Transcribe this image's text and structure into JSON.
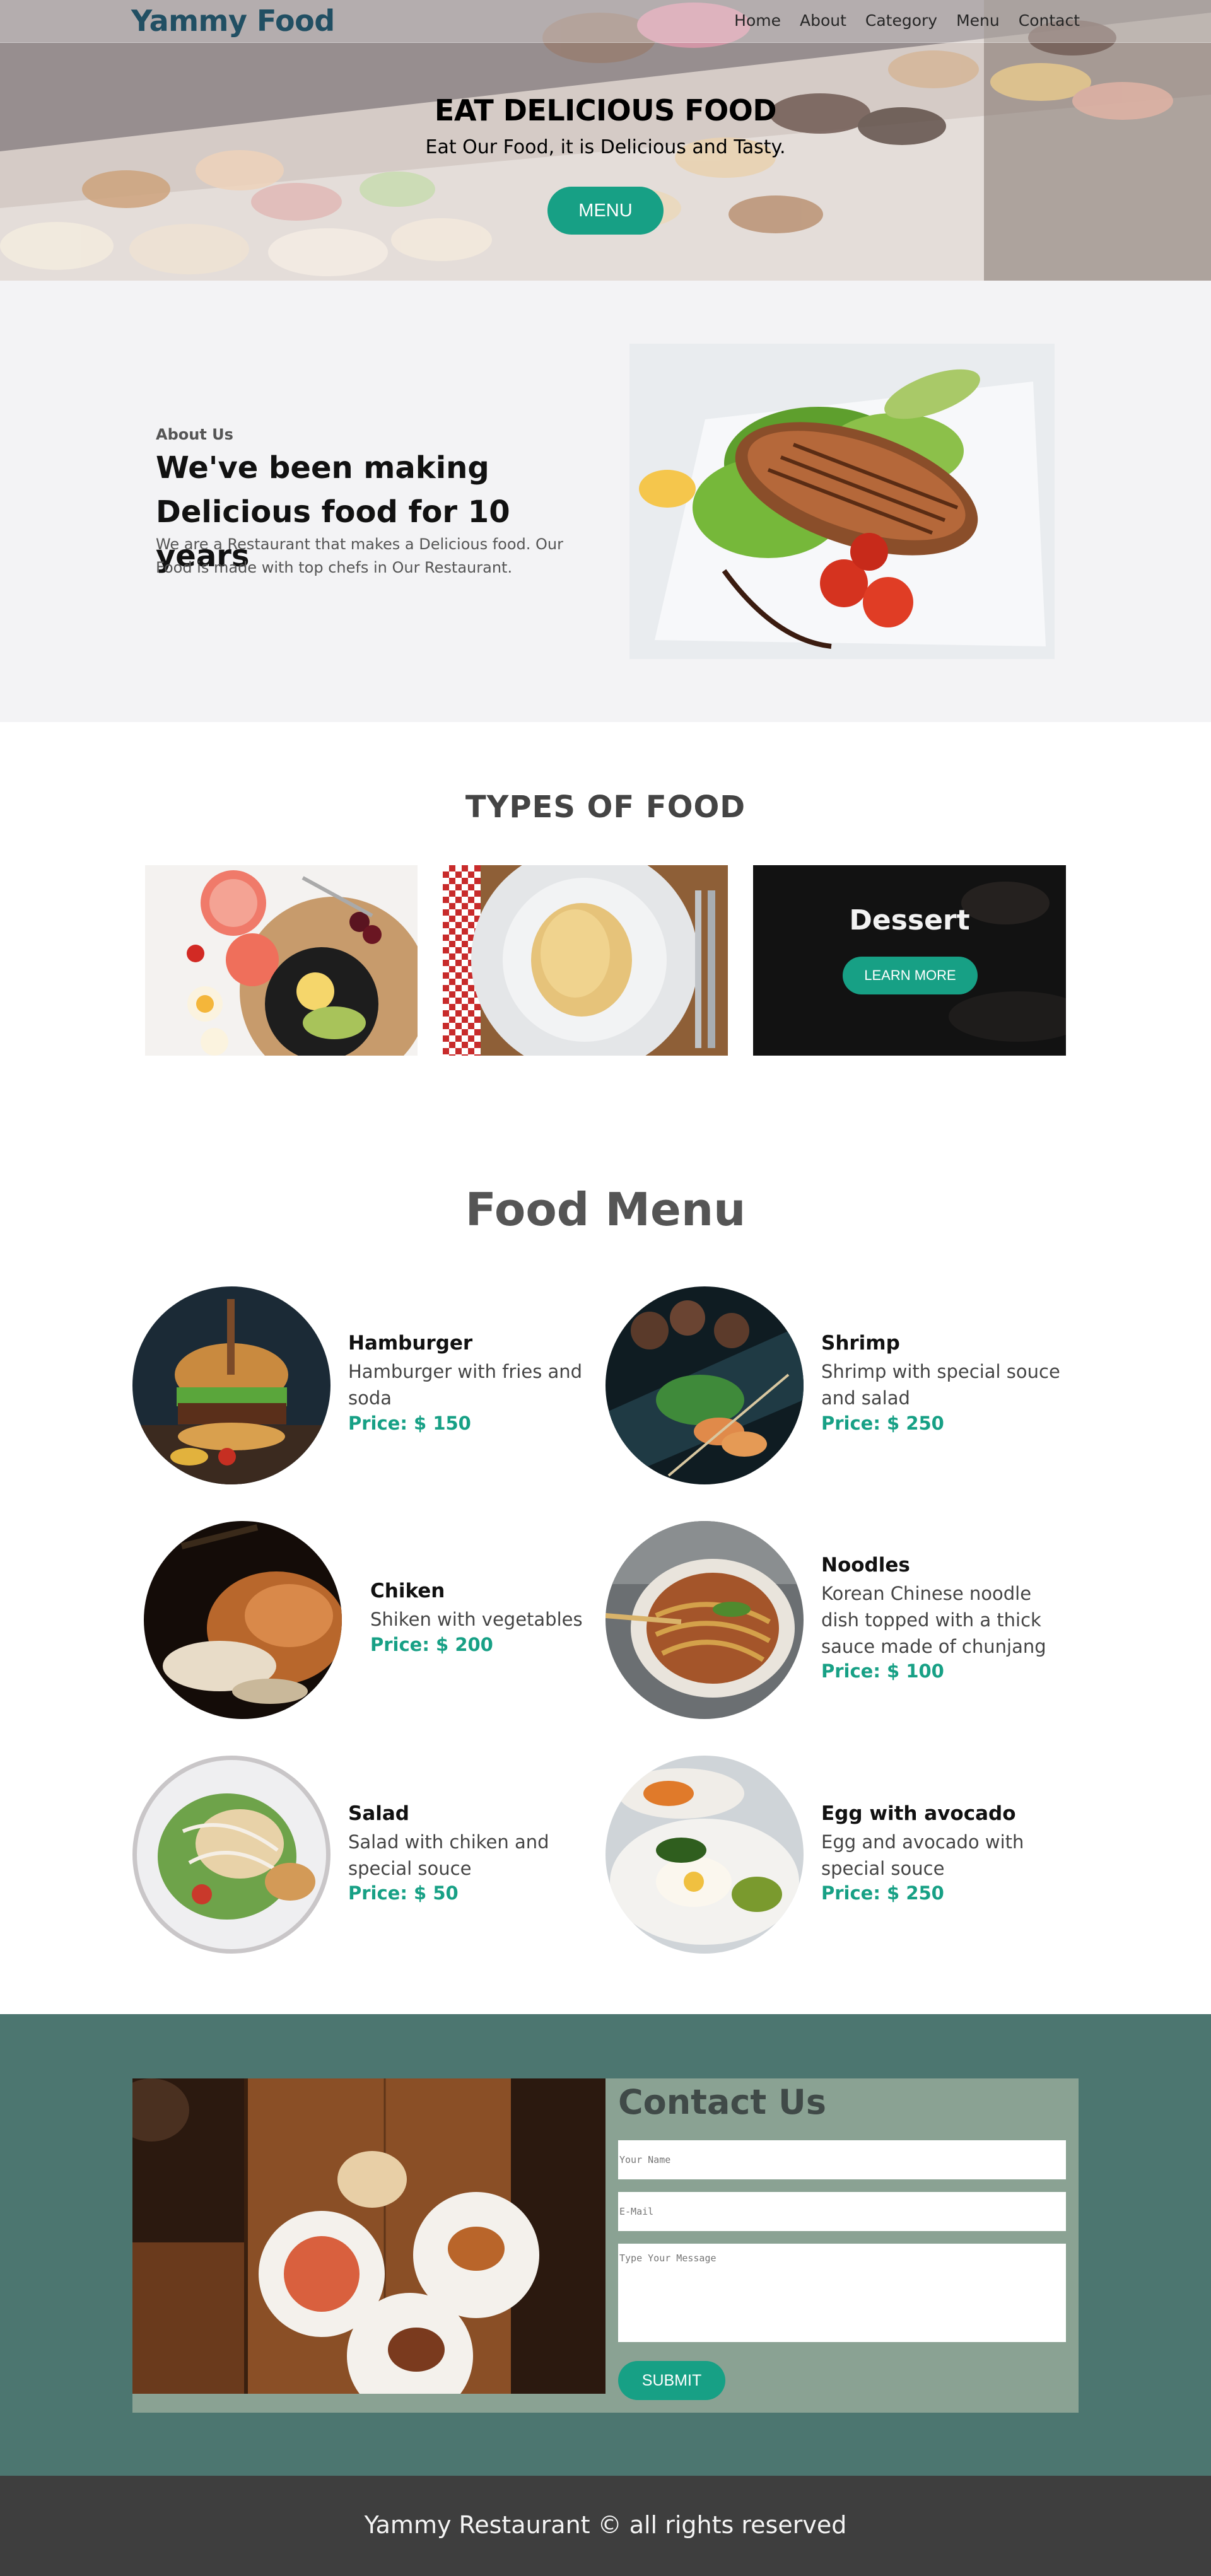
{
  "header": {
    "logo": "Yammy Food",
    "nav": [
      "Home",
      "About",
      "Category",
      "Menu",
      "Contact"
    ]
  },
  "hero": {
    "title": "EAT DELICIOUS FOOD",
    "subtitle": "Eat Our Food, it is Delicious and Tasty.",
    "button": "MENU"
  },
  "about": {
    "kicker": "About Us",
    "title": "We've been making Delicious food for 10 years",
    "text": "We are a Restaurant that makes a Delicious food. Our Food is made with top chefs in Our Restaurant."
  },
  "types": {
    "title": "TYPES OF FOOD",
    "dessert_title": "Dessert",
    "learn_more": "LEARN MORE"
  },
  "menu": {
    "title": "Food Menu",
    "items": [
      {
        "name": "Hamburger",
        "desc": "Hamburger with fries and soda",
        "price": "Price: $ 150"
      },
      {
        "name": "Shrimp",
        "desc": "Shrimp with special souce and salad",
        "price": "Price: $ 250"
      },
      {
        "name": "Chiken",
        "desc": "Shiken with vegetables",
        "price": "Price: $ 200"
      },
      {
        "name": "Noodles",
        "desc": "Korean Chinese noodle dish topped with a thick sauce made of chunjang",
        "price": "Price: $ 100"
      },
      {
        "name": "Salad",
        "desc": "Salad with chiken and special souce",
        "price": "Price: $ 50"
      },
      {
        "name": "Egg with avocado",
        "desc": "Egg and avocado with special souce",
        "price": "Price: $ 250"
      }
    ]
  },
  "contact": {
    "title": "Contact Us",
    "name_placeholder": "Your Name",
    "email_placeholder": "E-Mail",
    "message_placeholder": "Type Your Message",
    "submit": "SUBMIT"
  },
  "footer": {
    "text": "Yammy Restaurant © all rights reserved"
  },
  "colors": {
    "accent": "#17a085",
    "logo": "#214f63",
    "contact_bg": "#4c7670",
    "contact_panel": "#8aa293",
    "footer_bg": "#3e3e3e"
  }
}
